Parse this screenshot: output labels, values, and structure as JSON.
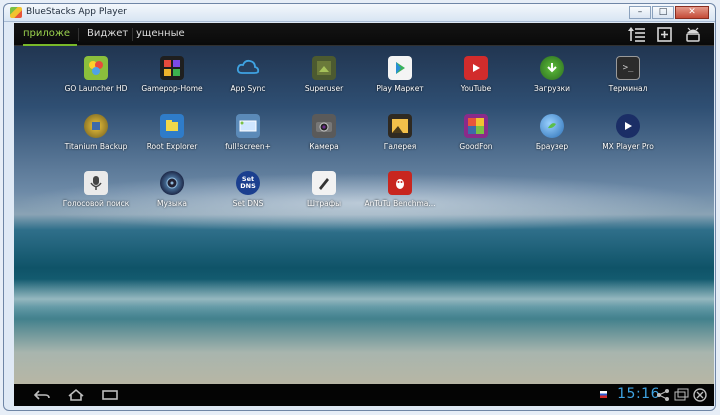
{
  "window": {
    "title": "BlueStacks App Player",
    "btn_min": "–",
    "btn_max": "□",
    "btn_close": "✕"
  },
  "tabs": [
    {
      "label": "Приложения",
      "display": "приложе"
    },
    {
      "label": "Виджет"
    },
    {
      "label": "Загруженные",
      "display": "ущенные"
    }
  ],
  "apps": [
    {
      "label": "GO Launcher HD",
      "icon": "go-launcher-icon",
      "color": "#8bbf3c"
    },
    {
      "label": "Gamepop-Home",
      "icon": "gamepop-icon",
      "color": "#1f1f1f"
    },
    {
      "label": "App Sync",
      "icon": "cloud-sync-icon",
      "color": "transparent"
    },
    {
      "label": "Superuser",
      "icon": "superuser-icon",
      "color": "#6b7a3a"
    },
    {
      "label": "Play Маркет",
      "icon": "play-store-icon",
      "color": "#f4f4f4"
    },
    {
      "label": "YouTube",
      "icon": "youtube-icon",
      "color": "#d22c2c"
    },
    {
      "label": "Загрузки",
      "icon": "download-icon",
      "color": "#3a8a2a"
    },
    {
      "label": "Терминал",
      "icon": "terminal-icon",
      "color": "#2b2b2b"
    },
    {
      "label": "Titanium Backup",
      "icon": "titanium-backup-icon",
      "color": "#3f6aa8"
    },
    {
      "label": "Root Explorer",
      "icon": "root-explorer-icon",
      "color": "#2f7cc9"
    },
    {
      "label": "full!screen+",
      "icon": "fullscreen-icon",
      "color": "#5b8ab8"
    },
    {
      "label": "Камера",
      "icon": "camera-icon",
      "color": "#5a5a5a"
    },
    {
      "label": "Галерея",
      "icon": "gallery-icon",
      "color": "#2f2a22"
    },
    {
      "label": "GoodFon",
      "icon": "goodfon-icon",
      "color": "#8a2b8a"
    },
    {
      "label": "Браузер",
      "icon": "browser-icon",
      "color": "#2a6fb5"
    },
    {
      "label": "MX Player Pro",
      "icon": "mx-player-icon",
      "color": "#1b2e66"
    },
    {
      "label": "Голосовой поиск",
      "icon": "voice-search-icon",
      "color": "#eaeaea"
    },
    {
      "label": "Музыка",
      "icon": "music-icon",
      "color": "#1e2a4a"
    },
    {
      "label": "Set DNS",
      "icon": "set-dns-icon",
      "color": "#1b3f8f",
      "text": "Set\nDNS"
    },
    {
      "label": "Штрафы",
      "icon": "fines-icon",
      "color": "#f2f2f2"
    },
    {
      "label": "AnTuTu Benchma...",
      "icon": "antutu-icon",
      "color": "#c8261f"
    }
  ],
  "status": {
    "time": "15:16"
  }
}
